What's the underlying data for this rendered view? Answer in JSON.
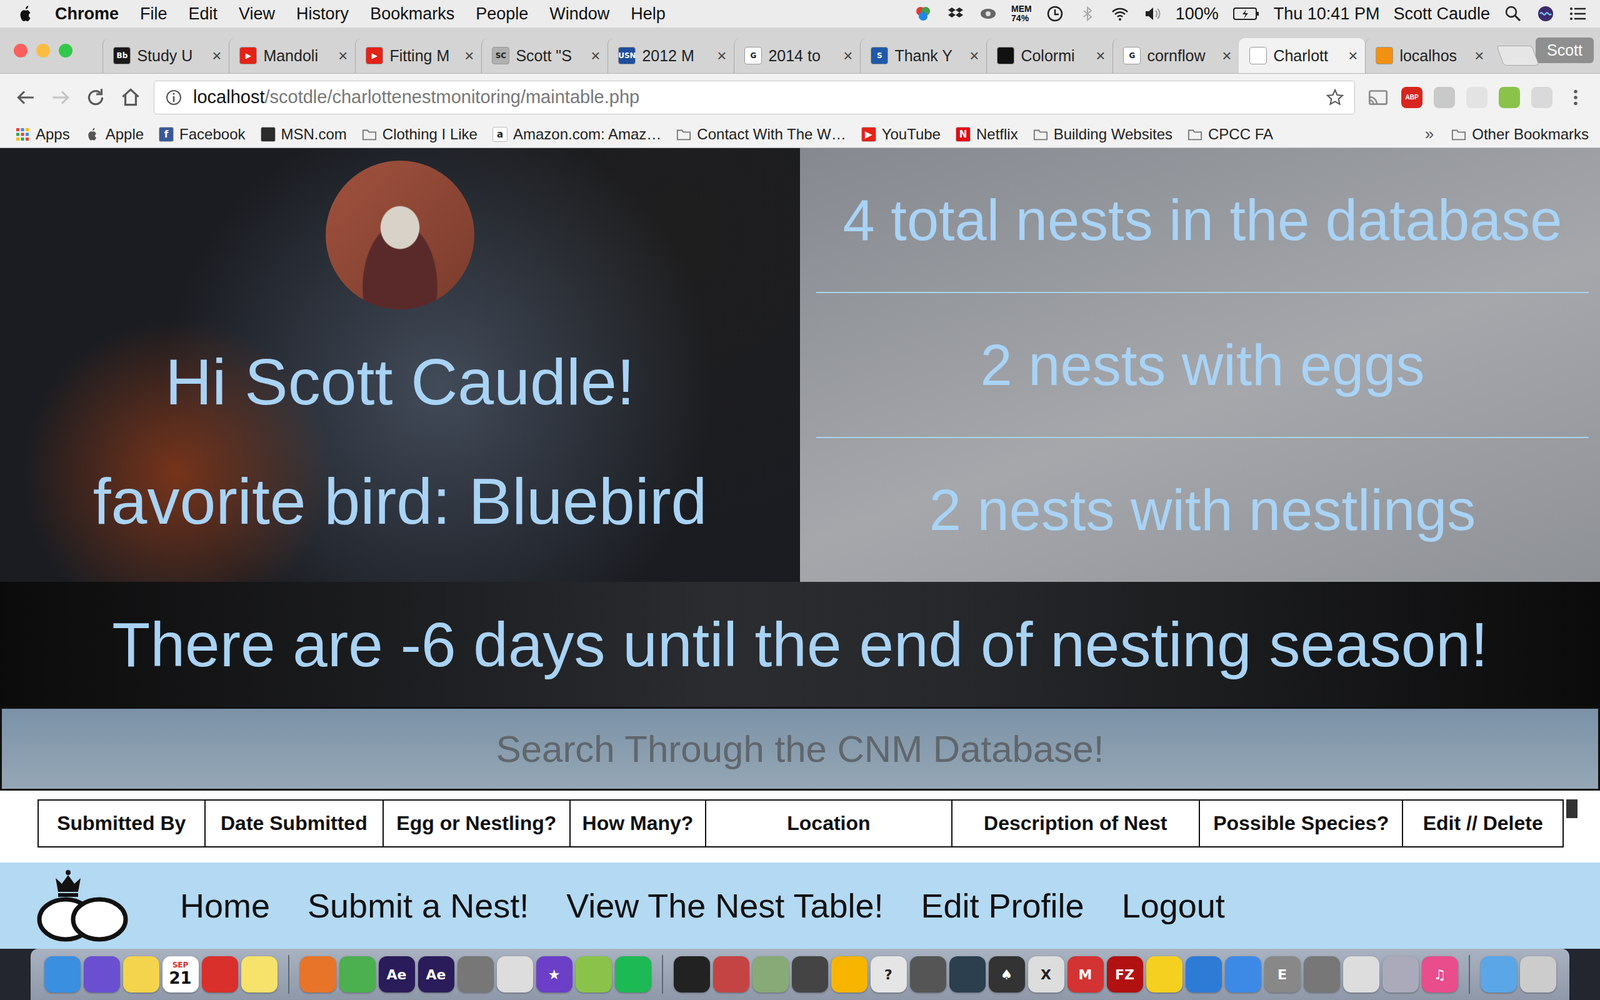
{
  "menubar": {
    "app": "Chrome",
    "menus": [
      "File",
      "Edit",
      "View",
      "History",
      "Bookmarks",
      "People",
      "Window",
      "Help"
    ],
    "mem_label": "MEM",
    "mem_value": "74%",
    "battery": "100%",
    "clock": "Thu 10:41 PM",
    "user": "Scott Caudle"
  },
  "tabstrip": {
    "close": "×",
    "profile": "Scott",
    "tabs": [
      {
        "label": "Study U",
        "badge": "Bb",
        "color": "#1a1a1a",
        "selected": false
      },
      {
        "label": "Mandoli",
        "badge": "▶",
        "color": "#e62117",
        "selected": false
      },
      {
        "label": "Fitting M",
        "badge": "▶",
        "color": "#e62117",
        "selected": false
      },
      {
        "label": "Scott \"S",
        "badge": "SC",
        "color": "#b0b0b0",
        "selected": false
      },
      {
        "label": "2012 M",
        "badge": "USN",
        "color": "#1f4e9c",
        "selected": false
      },
      {
        "label": "2014 to",
        "badge": "G",
        "color": "#ffffff",
        "selected": false
      },
      {
        "label": "Thank Y",
        "badge": "S",
        "color": "#1e5aa8",
        "selected": false
      },
      {
        "label": "Colormi",
        "badge": "",
        "color": "#111111",
        "selected": false
      },
      {
        "label": "cornflow",
        "badge": "G",
        "color": "#ffffff",
        "selected": false
      },
      {
        "label": "Charlott",
        "badge": "",
        "color": "#ffffff",
        "selected": true
      },
      {
        "label": "localhos",
        "badge": "",
        "color": "#f29111",
        "selected": false
      }
    ]
  },
  "toolbar": {
    "url_host": "localhost",
    "url_path": "/scotdle/charlottenestmonitoring/maintable.php",
    "extensions": [
      {
        "label": "ABP",
        "color": "#d7261e"
      },
      {
        "label": "",
        "color": "#c9c9c9"
      },
      {
        "label": "",
        "color": "#e3e3e3"
      },
      {
        "label": "",
        "color": "#8bc34a"
      },
      {
        "label": "",
        "color": "#d9d9d9"
      }
    ]
  },
  "bookmarks": {
    "more": "»",
    "other": "Other Bookmarks",
    "items": [
      {
        "label": "Apps",
        "kind": "apps",
        "badge": "",
        "color": "#e0e0e0"
      },
      {
        "label": "Apple",
        "kind": "apple",
        "badge": "",
        "color": "#555555"
      },
      {
        "label": "Facebook",
        "kind": "site",
        "badge": "f",
        "color": "#3b5998"
      },
      {
        "label": "MSN.com",
        "kind": "site",
        "badge": "",
        "color": "#2b2b2b"
      },
      {
        "label": "Clothing I Like",
        "kind": "folder",
        "badge": "",
        "color": "#777777"
      },
      {
        "label": "Amazon.com: Amaz…",
        "kind": "site",
        "badge": "a",
        "color": "#ffffff"
      },
      {
        "label": "Contact With The W…",
        "kind": "folder",
        "badge": "",
        "color": "#777777"
      },
      {
        "label": "YouTube",
        "kind": "site",
        "badge": "▶",
        "color": "#e62117"
      },
      {
        "label": "Netflix",
        "kind": "site",
        "badge": "N",
        "color": "#e50914"
      },
      {
        "label": "Building Websites",
        "kind": "folder",
        "badge": "",
        "color": "#777777"
      },
      {
        "label": "CPCC FA",
        "kind": "folder",
        "badge": "",
        "color": "#777777"
      }
    ]
  },
  "page": {
    "greeting": "Hi Scott Caudle!",
    "favorite": "favorite bird: Bluebird",
    "stats": [
      "4 total nests in the database",
      "2 nests with eggs",
      "2 nests with nestlings"
    ],
    "countdown": "There are -6 days until the end of nesting season!",
    "search_placeholder": "Search Through the CNM Database!",
    "table_columns": [
      "Submitted By",
      "Date Submitted",
      "Egg or Nestling?",
      "How Many?",
      "Location",
      "Description of Nest",
      "Possible Species?",
      "Edit // Delete"
    ],
    "nav": [
      "Home",
      "Submit a Nest!",
      "View The Nest Table!",
      "Edit Profile",
      "Logout"
    ]
  },
  "dock": [
    {
      "kind": "app",
      "color": "#3b8fe0",
      "glyph": ""
    },
    {
      "kind": "app",
      "color": "#6a4fd0",
      "glyph": ""
    },
    {
      "kind": "app",
      "color": "#f4d44c",
      "glyph": ""
    },
    {
      "kind": "calendar",
      "color": "#ffffff",
      "month": "SEP",
      "day": "21"
    },
    {
      "kind": "app",
      "color": "#d9302c",
      "glyph": ""
    },
    {
      "kind": "app",
      "color": "#f7e26b",
      "glyph": ""
    },
    {
      "kind": "separator"
    },
    {
      "kind": "app",
      "color": "#e8742a",
      "glyph": ""
    },
    {
      "kind": "app",
      "color": "#4caf50",
      "glyph": ""
    },
    {
      "kind": "app",
      "color": "#2a1c5a",
      "glyph": "Ae"
    },
    {
      "kind": "app",
      "color": "#2a1c5a",
      "glyph": "Ae"
    },
    {
      "kind": "app",
      "color": "#777777",
      "glyph": ""
    },
    {
      "kind": "app",
      "color": "#dddddd",
      "glyph": ""
    },
    {
      "kind": "app",
      "color": "#6b3fc7",
      "glyph": "★"
    },
    {
      "kind": "app",
      "color": "#8bc34a",
      "glyph": ""
    },
    {
      "kind": "app",
      "color": "#1db954",
      "glyph": ""
    },
    {
      "kind": "separator"
    },
    {
      "kind": "app",
      "color": "#222222",
      "glyph": ""
    },
    {
      "kind": "app",
      "color": "#c44444",
      "glyph": ""
    },
    {
      "kind": "app",
      "color": "#88aa77",
      "glyph": ""
    },
    {
      "kind": "app",
      "color": "#444444",
      "glyph": ""
    },
    {
      "kind": "app",
      "color": "#f7b500",
      "glyph": ""
    },
    {
      "kind": "app",
      "color": "#e5e5e5",
      "glyph": "?"
    },
    {
      "kind": "app",
      "color": "#555555",
      "glyph": ""
    },
    {
      "kind": "app",
      "color": "#2b3f4e",
      "glyph": ""
    },
    {
      "kind": "app",
      "color": "#333333",
      "glyph": "♠"
    },
    {
      "kind": "app",
      "color": "#dddddd",
      "glyph": "X"
    },
    {
      "kind": "app",
      "color": "#d33333",
      "glyph": "M"
    },
    {
      "kind": "app",
      "color": "#b11111",
      "glyph": "FZ"
    },
    {
      "kind": "app",
      "color": "#f5d020",
      "glyph": ""
    },
    {
      "kind": "app",
      "color": "#2e7bd6",
      "glyph": ""
    },
    {
      "kind": "app",
      "color": "#3d8ae6",
      "glyph": ""
    },
    {
      "kind": "app",
      "color": "#888888",
      "glyph": "E"
    },
    {
      "kind": "app",
      "color": "#777777",
      "glyph": ""
    },
    {
      "kind": "app",
      "color": "#dddddd",
      "glyph": ""
    },
    {
      "kind": "app",
      "color": "#aaaabb",
      "glyph": ""
    },
    {
      "kind": "app",
      "color": "#e94d8b",
      "glyph": "♫"
    },
    {
      "kind": "separator"
    },
    {
      "kind": "app",
      "color": "#5aa6e6",
      "glyph": ""
    },
    {
      "kind": "app",
      "color": "#cccccc",
      "glyph": ""
    }
  ]
}
